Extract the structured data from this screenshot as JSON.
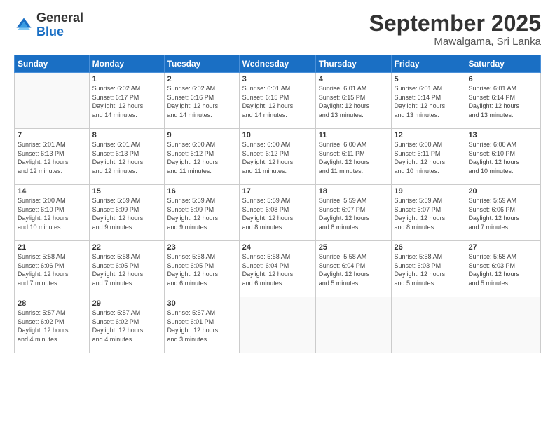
{
  "logo": {
    "general": "General",
    "blue": "Blue"
  },
  "header": {
    "month": "September 2025",
    "location": "Mawalgama, Sri Lanka"
  },
  "days_of_week": [
    "Sunday",
    "Monday",
    "Tuesday",
    "Wednesday",
    "Thursday",
    "Friday",
    "Saturday"
  ],
  "weeks": [
    [
      {
        "day": "",
        "info": ""
      },
      {
        "day": "1",
        "info": "Sunrise: 6:02 AM\nSunset: 6:17 PM\nDaylight: 12 hours\nand 14 minutes."
      },
      {
        "day": "2",
        "info": "Sunrise: 6:02 AM\nSunset: 6:16 PM\nDaylight: 12 hours\nand 14 minutes."
      },
      {
        "day": "3",
        "info": "Sunrise: 6:01 AM\nSunset: 6:15 PM\nDaylight: 12 hours\nand 14 minutes."
      },
      {
        "day": "4",
        "info": "Sunrise: 6:01 AM\nSunset: 6:15 PM\nDaylight: 12 hours\nand 13 minutes."
      },
      {
        "day": "5",
        "info": "Sunrise: 6:01 AM\nSunset: 6:14 PM\nDaylight: 12 hours\nand 13 minutes."
      },
      {
        "day": "6",
        "info": "Sunrise: 6:01 AM\nSunset: 6:14 PM\nDaylight: 12 hours\nand 13 minutes."
      }
    ],
    [
      {
        "day": "7",
        "info": "Sunrise: 6:01 AM\nSunset: 6:13 PM\nDaylight: 12 hours\nand 12 minutes."
      },
      {
        "day": "8",
        "info": "Sunrise: 6:01 AM\nSunset: 6:13 PM\nDaylight: 12 hours\nand 12 minutes."
      },
      {
        "day": "9",
        "info": "Sunrise: 6:00 AM\nSunset: 6:12 PM\nDaylight: 12 hours\nand 11 minutes."
      },
      {
        "day": "10",
        "info": "Sunrise: 6:00 AM\nSunset: 6:12 PM\nDaylight: 12 hours\nand 11 minutes."
      },
      {
        "day": "11",
        "info": "Sunrise: 6:00 AM\nSunset: 6:11 PM\nDaylight: 12 hours\nand 11 minutes."
      },
      {
        "day": "12",
        "info": "Sunrise: 6:00 AM\nSunset: 6:11 PM\nDaylight: 12 hours\nand 10 minutes."
      },
      {
        "day": "13",
        "info": "Sunrise: 6:00 AM\nSunset: 6:10 PM\nDaylight: 12 hours\nand 10 minutes."
      }
    ],
    [
      {
        "day": "14",
        "info": "Sunrise: 6:00 AM\nSunset: 6:10 PM\nDaylight: 12 hours\nand 10 minutes."
      },
      {
        "day": "15",
        "info": "Sunrise: 5:59 AM\nSunset: 6:09 PM\nDaylight: 12 hours\nand 9 minutes."
      },
      {
        "day": "16",
        "info": "Sunrise: 5:59 AM\nSunset: 6:09 PM\nDaylight: 12 hours\nand 9 minutes."
      },
      {
        "day": "17",
        "info": "Sunrise: 5:59 AM\nSunset: 6:08 PM\nDaylight: 12 hours\nand 8 minutes."
      },
      {
        "day": "18",
        "info": "Sunrise: 5:59 AM\nSunset: 6:07 PM\nDaylight: 12 hours\nand 8 minutes."
      },
      {
        "day": "19",
        "info": "Sunrise: 5:59 AM\nSunset: 6:07 PM\nDaylight: 12 hours\nand 8 minutes."
      },
      {
        "day": "20",
        "info": "Sunrise: 5:59 AM\nSunset: 6:06 PM\nDaylight: 12 hours\nand 7 minutes."
      }
    ],
    [
      {
        "day": "21",
        "info": "Sunrise: 5:58 AM\nSunset: 6:06 PM\nDaylight: 12 hours\nand 7 minutes."
      },
      {
        "day": "22",
        "info": "Sunrise: 5:58 AM\nSunset: 6:05 PM\nDaylight: 12 hours\nand 7 minutes."
      },
      {
        "day": "23",
        "info": "Sunrise: 5:58 AM\nSunset: 6:05 PM\nDaylight: 12 hours\nand 6 minutes."
      },
      {
        "day": "24",
        "info": "Sunrise: 5:58 AM\nSunset: 6:04 PM\nDaylight: 12 hours\nand 6 minutes."
      },
      {
        "day": "25",
        "info": "Sunrise: 5:58 AM\nSunset: 6:04 PM\nDaylight: 12 hours\nand 5 minutes."
      },
      {
        "day": "26",
        "info": "Sunrise: 5:58 AM\nSunset: 6:03 PM\nDaylight: 12 hours\nand 5 minutes."
      },
      {
        "day": "27",
        "info": "Sunrise: 5:58 AM\nSunset: 6:03 PM\nDaylight: 12 hours\nand 5 minutes."
      }
    ],
    [
      {
        "day": "28",
        "info": "Sunrise: 5:57 AM\nSunset: 6:02 PM\nDaylight: 12 hours\nand 4 minutes."
      },
      {
        "day": "29",
        "info": "Sunrise: 5:57 AM\nSunset: 6:02 PM\nDaylight: 12 hours\nand 4 minutes."
      },
      {
        "day": "30",
        "info": "Sunrise: 5:57 AM\nSunset: 6:01 PM\nDaylight: 12 hours\nand 3 minutes."
      },
      {
        "day": "",
        "info": ""
      },
      {
        "day": "",
        "info": ""
      },
      {
        "day": "",
        "info": ""
      },
      {
        "day": "",
        "info": ""
      }
    ]
  ]
}
